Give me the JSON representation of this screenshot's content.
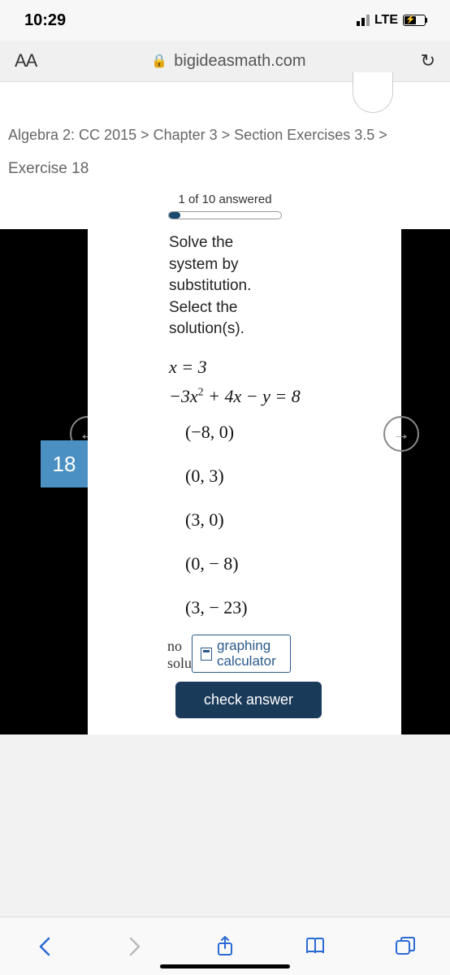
{
  "status": {
    "time": "10:29",
    "network": "LTE"
  },
  "urlbar": {
    "aa": "AA",
    "domain": "bigideasmath.com"
  },
  "breadcrumb": "Algebra 2: CC 2015 > Chapter 3 > Section Exercises 3.5 >",
  "exercise_title": "Exercise 18",
  "progress_text": "1 of 10 answered",
  "question": {
    "number": "18",
    "prompt": "Solve the system by substitution. Select the solution(s).",
    "eq1": "x = 3",
    "eq2": "−3x² + 4x − y = 8",
    "answers": [
      "(−8, 0)",
      "(0, 3)",
      "(3, 0)",
      "(0, − 8)",
      "(3, − 23)"
    ],
    "no_solution": "no solution",
    "calc_label": "graphing calculator",
    "check_label": "check answer"
  }
}
